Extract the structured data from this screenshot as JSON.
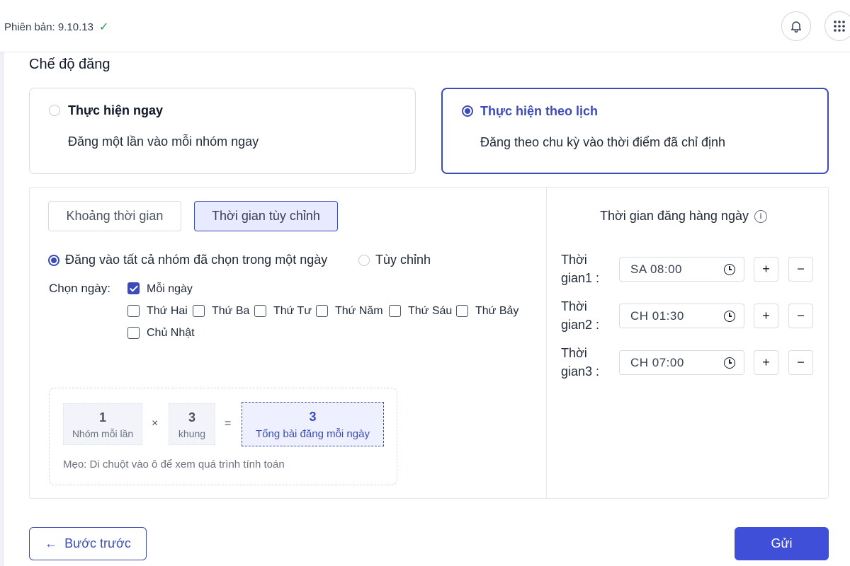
{
  "topbar": {
    "version_label": "Phiên bản: 9.10.13",
    "icons": [
      "check-icon",
      "bell-icon",
      "apps-grid-icon"
    ]
  },
  "section_title": "Chế độ đăng",
  "modes": {
    "immediate": {
      "title": "Thực hiện ngay",
      "desc": "Đăng một lần vào mỗi nhóm ngay",
      "selected": false
    },
    "scheduled": {
      "title": "Thực hiện theo lịch",
      "desc": "Đăng theo chu kỳ vào thời điểm đã chỉ định",
      "selected": true
    }
  },
  "tabs": {
    "interval": "Khoảng thời gian",
    "custom": "Thời gian tùy chỉnh",
    "active": "custom"
  },
  "post_options": {
    "all_groups": "Đăng vào tất cả nhóm đã chọn trong một ngày",
    "custom": "Tùy chỉnh",
    "selected": "all_groups"
  },
  "days": {
    "label": "Chọn ngày:",
    "every_day": "Mỗi ngày",
    "mon": "Thứ Hai",
    "tue": "Thứ Ba",
    "wed": "Thứ Tư",
    "thu": "Thứ Năm",
    "fri": "Thứ Sáu",
    "sat": "Thứ Bảy",
    "sun": "Chủ Nhật",
    "checked": [
      "every_day"
    ]
  },
  "calc": {
    "groups_value": "1",
    "groups_caption": "Nhóm mỗi lần",
    "times_symbol": "×",
    "slots_value": "3",
    "slots_caption": "khung",
    "equals_symbol": "=",
    "total_value": "3",
    "total_caption": "Tổng bài đăng mỗi ngày",
    "tip": "Mẹo: Di chuột vào ô để xem quá trình tính toán"
  },
  "schedule": {
    "title": "Thời gian đăng hàng ngày",
    "slots": [
      {
        "label_line1": "Thời",
        "label_line2": "gian1 :",
        "value": "SA 08:00"
      },
      {
        "label_line1": "Thời",
        "label_line2": "gian2 :",
        "value": "CH 01:30"
      },
      {
        "label_line1": "Thời",
        "label_line2": "gian3 :",
        "value": "CH 07:00"
      }
    ],
    "add_symbol": "+",
    "remove_symbol": "−"
  },
  "footer": {
    "back_label": "Bước trước",
    "back_arrow": "←",
    "send_label": "Gửi"
  },
  "colors": {
    "accent": "#3b4cb8",
    "primary_button": "#3f4fd8",
    "success": "#16a34a"
  }
}
